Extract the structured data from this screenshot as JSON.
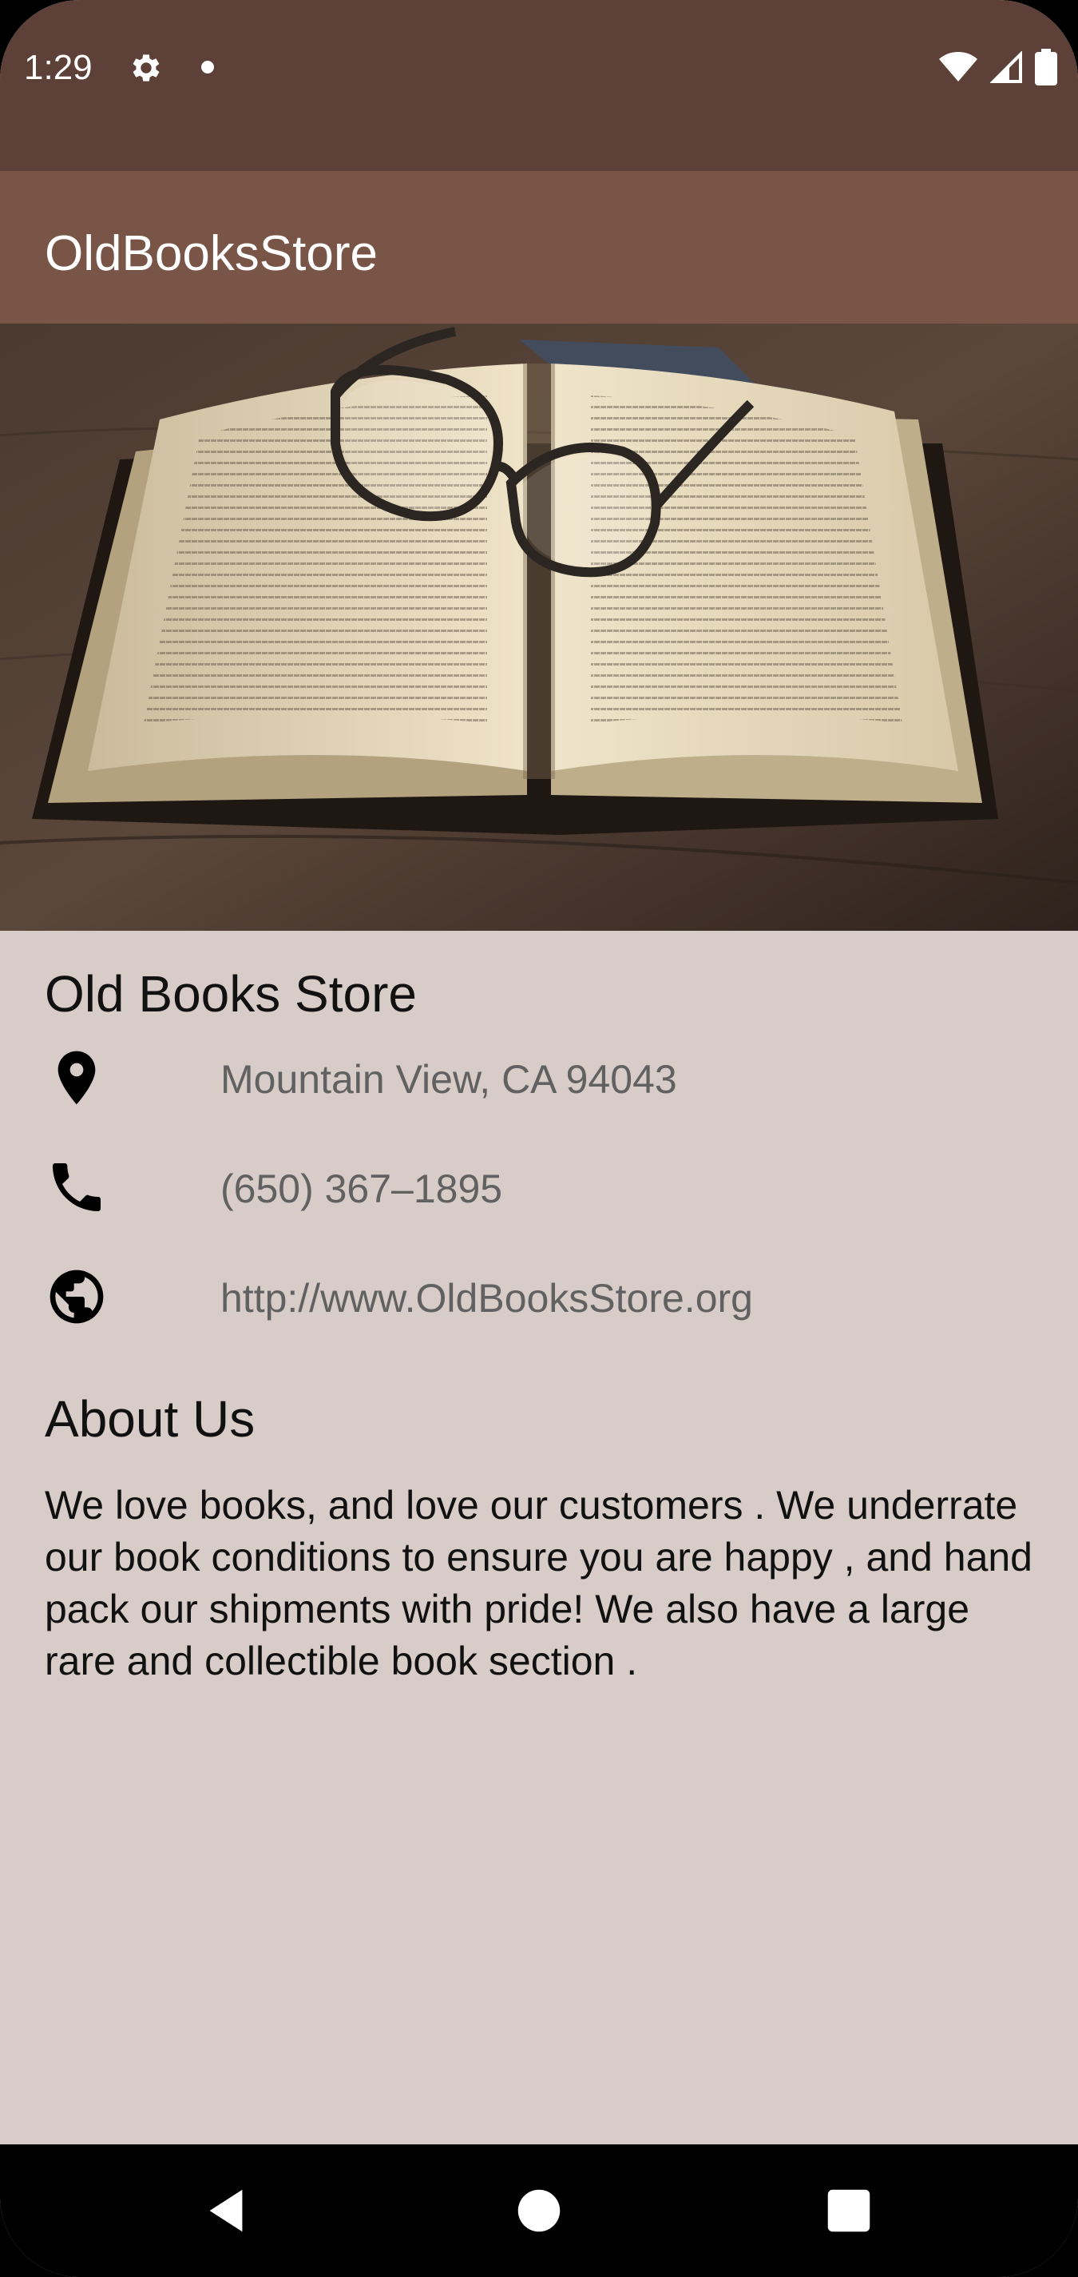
{
  "status_bar": {
    "time": "1:29",
    "icons": [
      "settings-icon",
      "notification-dot",
      "wifi-icon",
      "signal-icon",
      "battery-icon"
    ],
    "colors": {
      "background": "#5d4037"
    }
  },
  "app_bar": {
    "title": "OldBooksStore",
    "colors": {
      "background": "#795548"
    }
  },
  "hero": {
    "image": "open-book-with-glasses"
  },
  "store": {
    "name": "Old Books Store",
    "address": "Mountain View, CA 94043",
    "phone": "(650) 367–1895",
    "website": "http://www.OldBooksStore.org",
    "icons": [
      "location-pin-icon",
      "phone-icon",
      "globe-icon"
    ]
  },
  "about": {
    "title": "About Us",
    "body": "We love books, and love our customers . We underrate our book conditions to ensure you are happy , and hand pack our shipments with pride! We also have a large rare and collectible book section ."
  },
  "nav_bar": {
    "buttons": [
      "back-button",
      "home-button",
      "recents-button"
    ]
  },
  "colors": {
    "content_background": "#d7ccc8",
    "secondary_text": "#616161"
  }
}
